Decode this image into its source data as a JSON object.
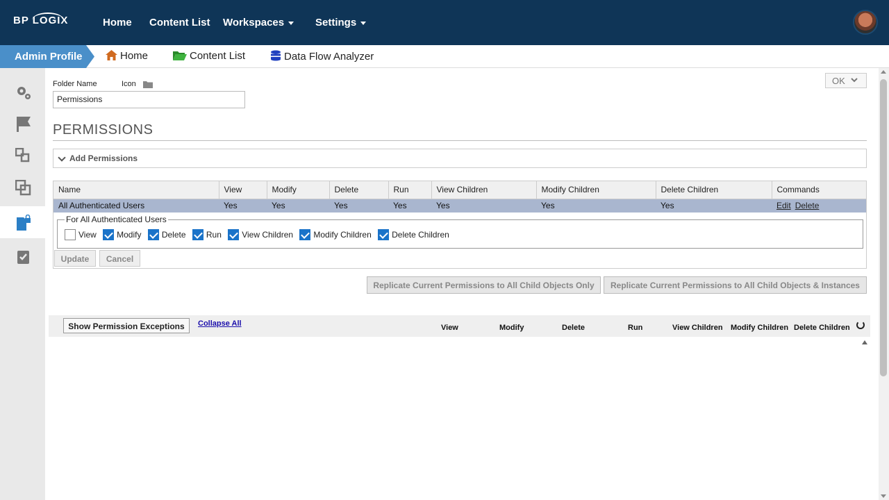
{
  "topbar": {
    "logo": "BP LOGIX",
    "nav": [
      {
        "label": "Home"
      },
      {
        "label": "Content List"
      },
      {
        "label": "Workspaces"
      },
      {
        "label": "Settings"
      }
    ]
  },
  "breadcrumb": {
    "admin": "Admin Profile",
    "home": "Home",
    "content_list": "Content List",
    "data_flow": "Data Flow Analyzer"
  },
  "form": {
    "folder_name_label": "Folder Name",
    "icon_label": "Icon",
    "folder_name_value": "Permissions",
    "ok_label": "OK"
  },
  "permissions": {
    "title": "PERMISSIONS",
    "add_label": "Add Permissions",
    "columns": [
      "Name",
      "View",
      "Modify",
      "Delete",
      "Run",
      "View Children",
      "Modify Children",
      "Delete Children",
      "Commands"
    ],
    "rows": [
      {
        "name": "All Authenticated Users",
        "view": "Yes",
        "modify": "Yes",
        "delete": "Yes",
        "run": "Yes",
        "view_children": "Yes",
        "modify_children": "Yes",
        "delete_children": "Yes",
        "edit": "Edit",
        "del": "Delete"
      }
    ],
    "editor": {
      "legend": "For All Authenticated Users",
      "options": [
        {
          "label": "View",
          "checked": false
        },
        {
          "label": "Modify",
          "checked": true
        },
        {
          "label": "Delete",
          "checked": true
        },
        {
          "label": "Run",
          "checked": true
        },
        {
          "label": "View Children",
          "checked": true
        },
        {
          "label": "Modify Children",
          "checked": true
        },
        {
          "label": "Delete Children",
          "checked": true
        }
      ],
      "update_label": "Update",
      "cancel_label": "Cancel"
    },
    "replicate_children": "Replicate Current Permissions to All Child Objects Only",
    "replicate_instances": "Replicate Current Permissions to All Child Objects & Instances"
  },
  "exceptions": {
    "show_label": "Show Permission Exceptions",
    "collapse_label": "Collapse All",
    "columns": [
      "View",
      "Modify",
      "Delete",
      "Run",
      "View Children",
      "Modify Children",
      "Delete Children"
    ]
  },
  "colors": {
    "topbar": "#0f3557",
    "accent": "#4a8fc9",
    "selected_row": "#a9b6cf",
    "checkbox": "#1a73c9"
  }
}
